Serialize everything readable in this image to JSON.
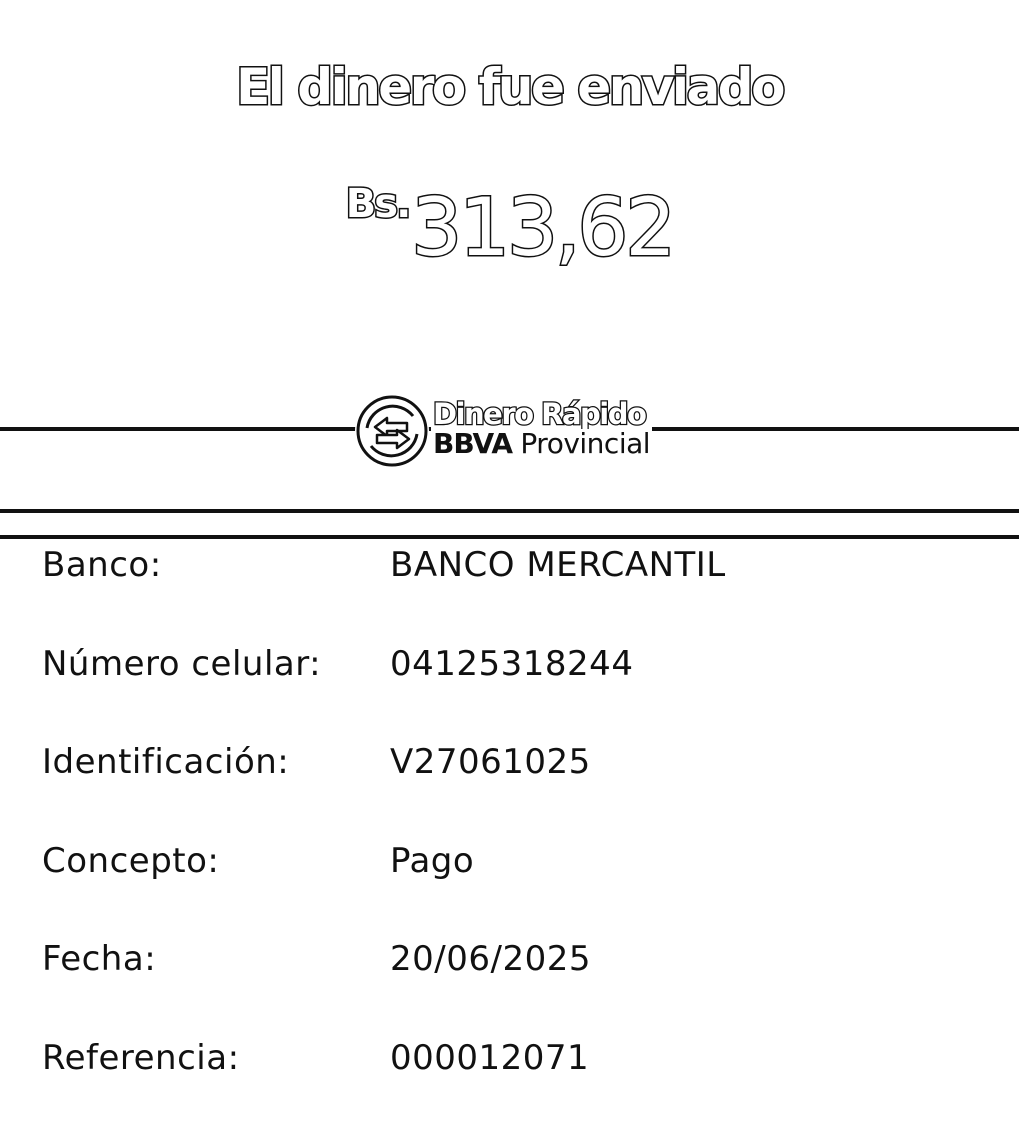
{
  "header": {
    "title": "El dinero fue enviado"
  },
  "amount": {
    "currency": "Bs.",
    "value": "313,62"
  },
  "logo": {
    "line1": "Dinero Rápido",
    "brand": "BBVA",
    "name": "Provincial",
    "icon": "exchange-arrows-icon"
  },
  "details": {
    "rows": [
      {
        "label": "Banco:",
        "value": "BANCO MERCANTIL"
      },
      {
        "label": "Número celular:",
        "value": "04125318244"
      },
      {
        "label": "Identificación:",
        "value": "V27061025"
      },
      {
        "label": "Concepto:",
        "value": "Pago"
      },
      {
        "label": "Fecha:",
        "value": "20/06/2025"
      },
      {
        "label": "Referencia:",
        "value": "000012071"
      }
    ]
  },
  "colors": {
    "ink": "#111111",
    "background": "#ffffff"
  }
}
